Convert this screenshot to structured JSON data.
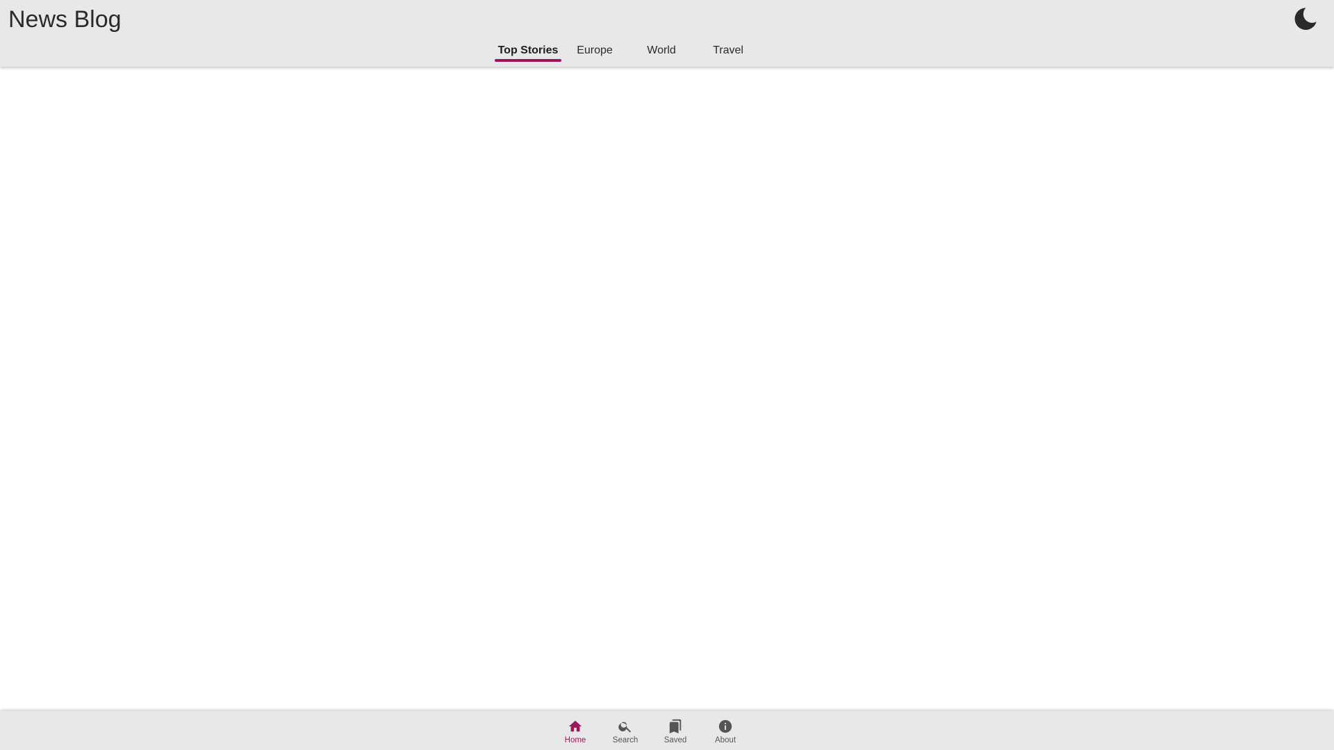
{
  "app": {
    "title": "News Blog"
  },
  "header": {
    "theme_toggle_icon": "moon-icon"
  },
  "tabs": [
    {
      "label": "Top Stories",
      "active": true
    },
    {
      "label": "Europe",
      "active": false
    },
    {
      "label": "World",
      "active": false
    },
    {
      "label": "Travel",
      "active": false
    }
  ],
  "bottom_nav": {
    "items": [
      {
        "label": "Home",
        "icon": "home-icon",
        "active": true
      },
      {
        "label": "Search",
        "icon": "search-icon",
        "active": false
      },
      {
        "label": "Saved",
        "icon": "bookmarks-icon",
        "active": false
      },
      {
        "label": "About",
        "icon": "info-icon",
        "active": false
      }
    ]
  },
  "colors": {
    "accent": "#a0155a",
    "bar_background": "#e8e8e8",
    "text": "#2a2a2a",
    "icon_inactive": "#555555"
  }
}
